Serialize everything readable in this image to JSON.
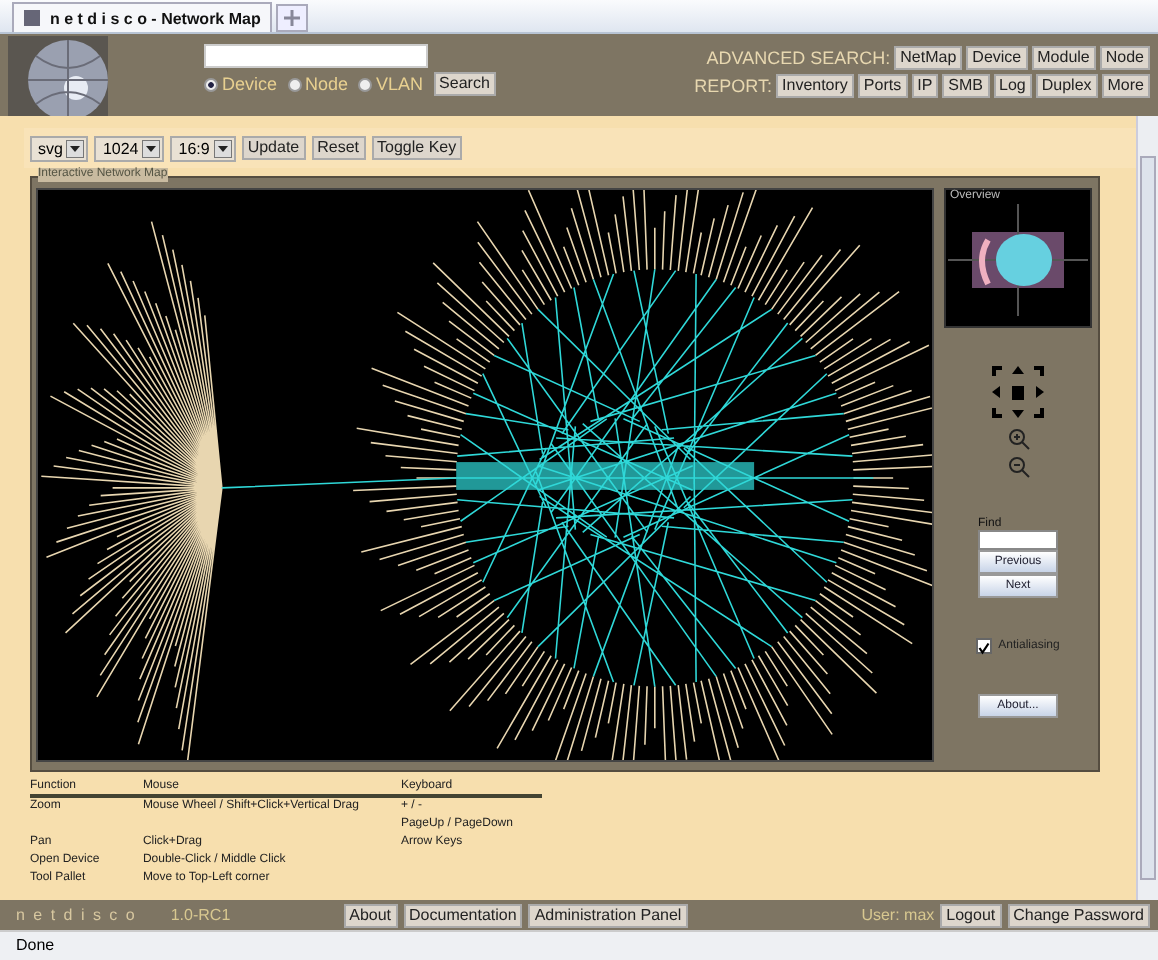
{
  "browser": {
    "tab_title": "n e t d i s c o - Network Map",
    "status": "Done"
  },
  "header": {
    "scopes": [
      {
        "label": "Device",
        "selected": true
      },
      {
        "label": "Node",
        "selected": false
      },
      {
        "label": "VLAN",
        "selected": false
      }
    ],
    "search_button": "Search",
    "advanced_search": {
      "label": "ADVANCED SEARCH:",
      "buttons": [
        "NetMap",
        "Device",
        "Module",
        "Node"
      ]
    },
    "report": {
      "label": "REPORT:",
      "buttons": [
        "Inventory",
        "Ports",
        "IP",
        "SMB",
        "Log",
        "Duplex",
        "More"
      ]
    }
  },
  "toolbar": {
    "selects": [
      "svg",
      "1024",
      "16:9"
    ],
    "buttons": [
      "Update",
      "Reset",
      "Toggle Key"
    ]
  },
  "map_panel": {
    "title": "Interactive Network Map"
  },
  "tool_panel": {
    "overview_title": "Overview",
    "find_label": "Find",
    "find_buttons": [
      "Previous",
      "Next"
    ],
    "antialiasing": {
      "label": "Antialiasing",
      "checked": true
    },
    "about_button": "About..."
  },
  "key": {
    "columns": [
      "Function",
      "Mouse",
      "Keyboard"
    ],
    "rows": [
      [
        "Zoom",
        "Mouse Wheel / Shift+Click+Vertical Drag",
        "+ / -"
      ],
      [
        "",
        "",
        "PageUp / PageDown"
      ],
      [
        "Pan",
        "Click+Drag",
        "Arrow Keys"
      ],
      [
        "Open Device",
        "Double-Click / Middle Click",
        ""
      ],
      [
        "Tool Pallet",
        "Move to Top-Left corner",
        ""
      ]
    ]
  },
  "footer": {
    "brand": "n e t d i s c o",
    "version": "1.0-RC1",
    "buttons": [
      "About",
      "Documentation",
      "Administration Panel"
    ],
    "user": "User: max",
    "user_buttons": [
      "Logout",
      "Change Password"
    ]
  }
}
